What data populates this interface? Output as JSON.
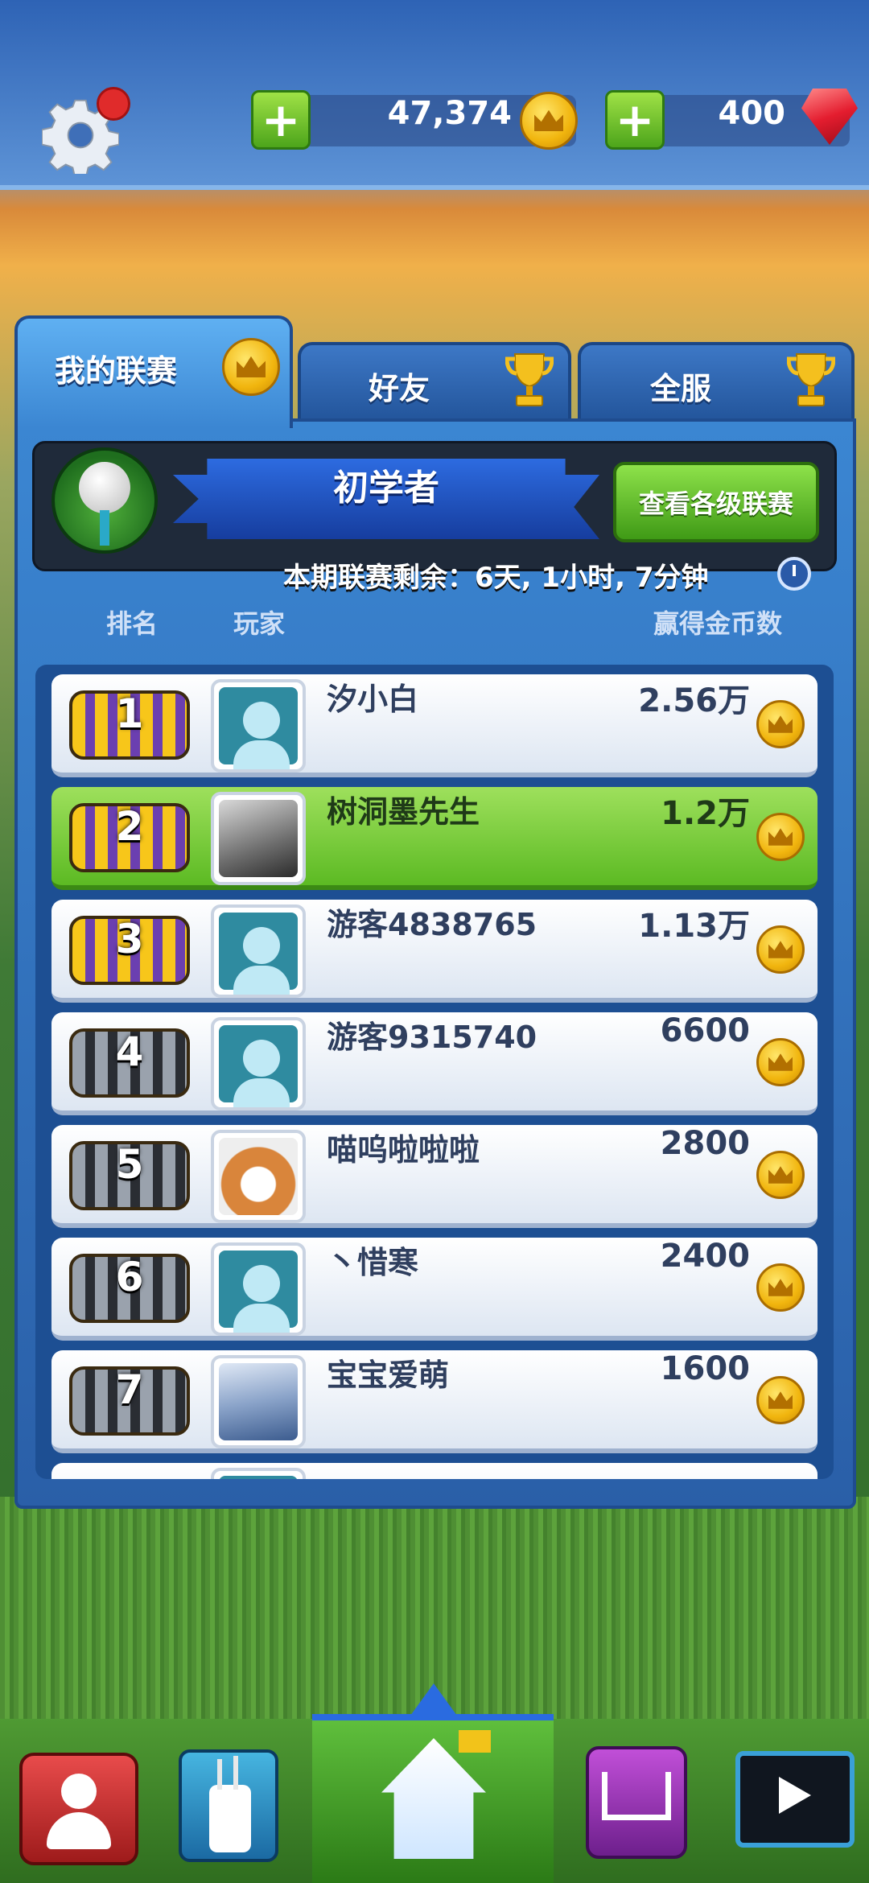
{
  "currency": {
    "coins": "47,374",
    "gems": "400",
    "coin_plus": "+",
    "gem_plus": "+"
  },
  "tabs": {
    "my_league": "我的联赛",
    "friends": "好友",
    "global": "全服"
  },
  "league": {
    "title": "初学者",
    "view_button": "查看各级联赛",
    "countdown": "本期联赛剩余：6天, 1小时, 7分钟"
  },
  "columns": {
    "rank": "排名",
    "player": "玩家",
    "coins_won": "赢得金币数"
  },
  "rows": [
    {
      "rank": "1",
      "name": "汐小白",
      "score": "2.56万"
    },
    {
      "rank": "2",
      "name": "树洞墨先生",
      "score": "1.2万"
    },
    {
      "rank": "3",
      "name": "游客4838765",
      "score": "1.13万"
    },
    {
      "rank": "4",
      "name": "游客9315740",
      "score": "6600"
    },
    {
      "rank": "5",
      "name": "喵呜啦啦啦",
      "score": "2800"
    },
    {
      "rank": "6",
      "name": "丶惜寒",
      "score": "2400"
    },
    {
      "rank": "7",
      "name": "宝宝爱萌",
      "score": "1600"
    }
  ],
  "icons": {
    "settings": "gear-icon",
    "coin": "coin-crown-icon",
    "gem": "ruby-gem-icon",
    "trophy": "trophy-icon",
    "clock": "clock-icon",
    "nav": [
      "team-icon",
      "golf-bag-icon",
      "home-icon",
      "shop-cart-icon",
      "video-icon"
    ]
  },
  "colors": {
    "accent_green": "#5cba23",
    "panel_blue": "#2a5fa8",
    "coin_gold": "#f1b50e"
  }
}
